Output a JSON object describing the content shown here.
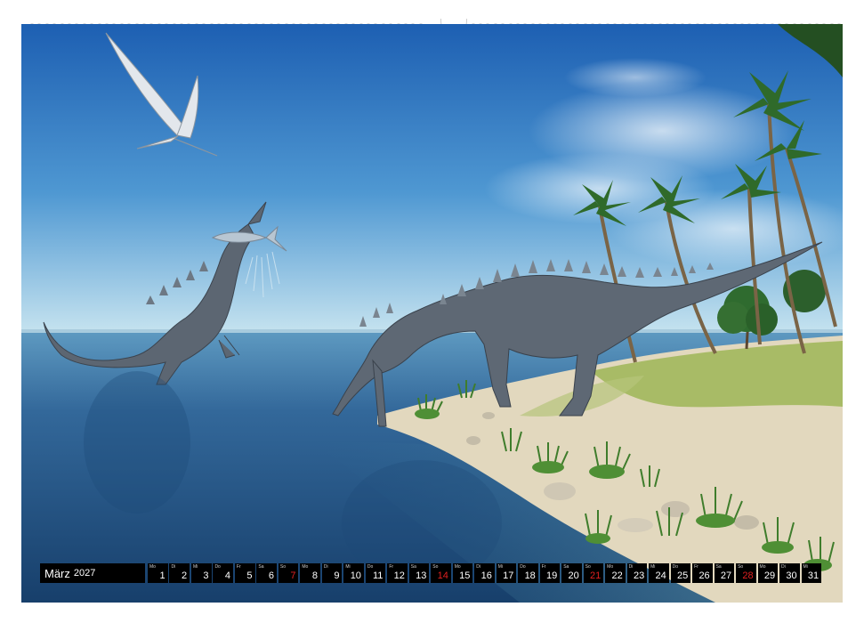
{
  "calendar": {
    "month": "März",
    "year": "2027",
    "days": [
      {
        "wd": "Mo",
        "num": "1"
      },
      {
        "wd": "Di",
        "num": "2"
      },
      {
        "wd": "Mi",
        "num": "3"
      },
      {
        "wd": "Do",
        "num": "4"
      },
      {
        "wd": "Fr",
        "num": "5"
      },
      {
        "wd": "Sa",
        "num": "6"
      },
      {
        "wd": "So",
        "num": "7"
      },
      {
        "wd": "Mo",
        "num": "8"
      },
      {
        "wd": "Di",
        "num": "9"
      },
      {
        "wd": "Mi",
        "num": "10"
      },
      {
        "wd": "Do",
        "num": "11"
      },
      {
        "wd": "Fr",
        "num": "12"
      },
      {
        "wd": "Sa",
        "num": "13"
      },
      {
        "wd": "So",
        "num": "14"
      },
      {
        "wd": "Mo",
        "num": "15"
      },
      {
        "wd": "Di",
        "num": "16"
      },
      {
        "wd": "Mi",
        "num": "17"
      },
      {
        "wd": "Do",
        "num": "18"
      },
      {
        "wd": "Fr",
        "num": "19"
      },
      {
        "wd": "Sa",
        "num": "20"
      },
      {
        "wd": "So",
        "num": "21"
      },
      {
        "wd": "Mo",
        "num": "22"
      },
      {
        "wd": "Di",
        "num": "23"
      },
      {
        "wd": "Mi",
        "num": "24"
      },
      {
        "wd": "Do",
        "num": "25"
      },
      {
        "wd": "Fr",
        "num": "26"
      },
      {
        "wd": "Sa",
        "num": "27"
      },
      {
        "wd": "So",
        "num": "28"
      },
      {
        "wd": "Mo",
        "num": "29"
      },
      {
        "wd": "Di",
        "num": "30"
      },
      {
        "wd": "Mi",
        "num": "31"
      }
    ]
  },
  "colors": {
    "sky_top": "#1f63b4",
    "sky_horizon": "#bfe0f0",
    "sea": "#2a5c8c",
    "sand": "#e6ddc5",
    "grass": "#a9bd63",
    "dino": "#5a6470",
    "sunday_text": "#e02020"
  }
}
